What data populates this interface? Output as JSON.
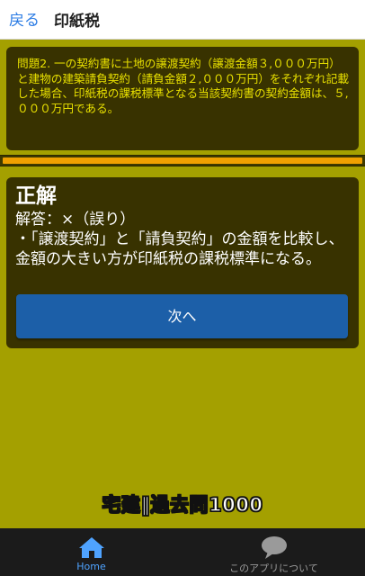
{
  "header": {
    "back_label": "戻る",
    "title": "印紙税"
  },
  "question": {
    "text": "問題2. 一の契約書に土地の譲渡契約（譲渡金額３,０００万円）と建物の建築請負契約（請負金額２,０００万円）をそれぞれ記載した場合、印紙税の課税標準となる当該契約書の契約金額は、５,０００万円である。"
  },
  "progress": {
    "value": 1.0
  },
  "answer": {
    "result": "正解",
    "answer_line": "解答：×（誤り）",
    "explanation": "・「譲渡契約」と「請負契約」の金額を比較し、金額の大きい方が印紙税の課税標準になる。",
    "next_label": "次へ"
  },
  "brand": {
    "logo_text": "宅建‖過去問1000"
  },
  "tabbar": {
    "items": [
      {
        "label": "Home",
        "icon": "home-icon",
        "active": true
      },
      {
        "label": "このアプリについて",
        "icon": "speech-bubble-icon",
        "active": false
      }
    ]
  },
  "colors": {
    "background": "#a4a000",
    "panel": "#383200",
    "question_text": "#e8e000",
    "progress": "#f0a000",
    "button": "#1c5fa8",
    "tab_active": "#4fa3ff",
    "tab_inactive": "#9a9a9a",
    "link": "#2a7be4"
  }
}
